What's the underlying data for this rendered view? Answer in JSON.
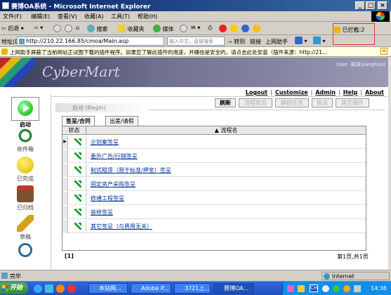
{
  "window": {
    "title": "赛博OA系统 - Microsoft Internet Explorer",
    "min": "_",
    "max": "□",
    "close": "×"
  },
  "menu": [
    "文件(F)",
    "编辑(E)",
    "查看(V)",
    "收藏(A)",
    "工具(T)",
    "帮助(H)"
  ],
  "toolbar": {
    "back": "后退",
    "search": "搜索",
    "favorites": "收藏夹",
    "media": "媒体",
    "input_hint": "输入中文，直接搜索",
    "go": "转到",
    "links": "链接",
    "helper": "上网助手",
    "blocked": "已拦截:2"
  },
  "address": {
    "label": "地址(D)",
    "url": "http://210.22.166.85/cmoa/Main.asp"
  },
  "infobar": {
    "text": "上网助手屏蔽了当前网站正试图下载的插件程序。如果您了解此插件的用途，并确信是安全的，请点击此处安装（插件来源：http://21..."
  },
  "banner": {
    "script_logo": "CyberMart",
    "user": "User: 蒋源(jianghao)"
  },
  "toplinks": [
    "Logout",
    "Customize",
    "Admin",
    "Help",
    "About"
  ],
  "sidebar": [
    {
      "label": "启动",
      "icon": "play-icon",
      "color": "#1aa31a"
    },
    {
      "label": "收件箱",
      "icon": "clock-inbox-icon",
      "color": "#2a8a3a"
    },
    {
      "label": "已完成",
      "icon": "smiley-icon",
      "color": "#f0d000"
    },
    {
      "label": "已归档",
      "icon": "archive-icon",
      "color": "#c0392b"
    },
    {
      "label": "草稿",
      "icon": "pencil-icon",
      "color": "#d4a017"
    },
    {
      "label": "",
      "icon": "search-icon",
      "color": "#2a6a9a"
    }
  ],
  "page_title": "启动 (Begin)",
  "actions": [
    {
      "label": "刷新",
      "enabled": true
    },
    {
      "label": "流程状态",
      "enabled": false
    },
    {
      "label": "群组任务",
      "enabled": false
    },
    {
      "label": "指派",
      "enabled": false
    },
    {
      "label": "其它操作",
      "enabled": false
    }
  ],
  "tabs": [
    "签呈/合同",
    "出差/请假"
  ],
  "table": {
    "columns": [
      "状态",
      "流程名"
    ],
    "rows": [
      "企划案签呈",
      "委外广告/行销签呈",
      "制式租赁（限于标准/押金）签呈",
      "固定资产采购签呈",
      "修缮工程签呈",
      "装修签呈",
      "其它签呈（与费用无关）"
    ]
  },
  "pager": {
    "pages": "[1]",
    "count": "第1页,共1页"
  },
  "status": {
    "text": "完毕",
    "zone": "Internet"
  },
  "taskbar": {
    "start": "开始",
    "tasks": [
      "本站网...",
      "Adobe P...",
      "3721上...",
      "赛博OA..."
    ],
    "lang": "CH",
    "time": "14:36"
  }
}
